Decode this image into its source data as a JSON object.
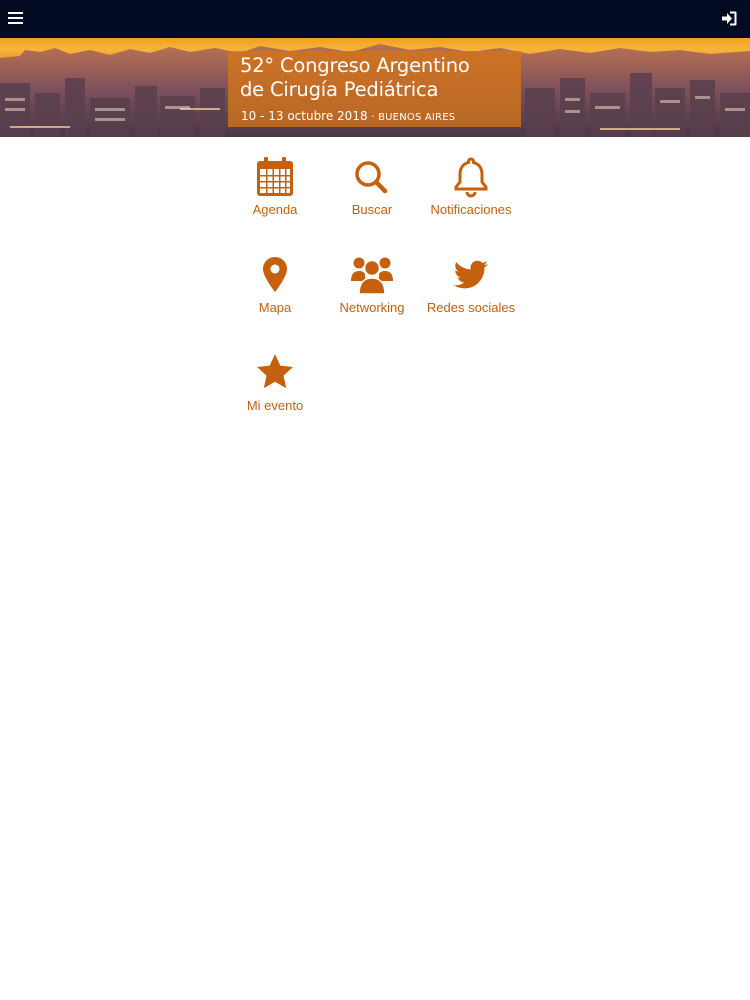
{
  "colors": {
    "topbar": "#020b22",
    "accent": "#c4600e",
    "banner_box": "#d57518"
  },
  "topbar": {
    "menu_icon": "hamburger-menu-icon",
    "login_icon": "sign-in-icon"
  },
  "banner": {
    "title_line1": "52° Congreso Argentino",
    "title_line2": "de Cirugía Pediátrica",
    "dates": "10 - 13 octubre 2018",
    "separator": " · ",
    "city": "BUENOS AIRES"
  },
  "menu": {
    "items": [
      {
        "label": "Agenda",
        "icon": "calendar-icon"
      },
      {
        "label": "Buscar",
        "icon": "search-icon"
      },
      {
        "label": "Notificaciones",
        "icon": "bell-icon"
      },
      {
        "label": "Mapa",
        "icon": "map-marker-icon"
      },
      {
        "label": "Networking",
        "icon": "users-icon"
      },
      {
        "label": "Redes sociales",
        "icon": "twitter-icon"
      },
      {
        "label": "Mi evento",
        "icon": "star-icon"
      }
    ]
  }
}
